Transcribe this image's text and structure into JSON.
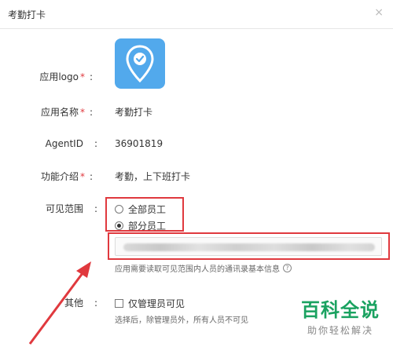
{
  "dialog": {
    "title": "考勤打卡",
    "close_glyph": "×"
  },
  "form": {
    "logo": {
      "label": "应用logo",
      "required_mark": "*",
      "colon": ":"
    },
    "name": {
      "label": "应用名称",
      "required_mark": "*",
      "colon": ":",
      "value": "考勤打卡"
    },
    "agent_id": {
      "label": "AgentID",
      "colon": ":",
      "value": "36901819"
    },
    "intro": {
      "label": "功能介绍",
      "required_mark": "*",
      "colon": ":",
      "value": "考勤，上下班打卡"
    },
    "visible_scope": {
      "label": "可见范围",
      "colon": ":",
      "options": [
        {
          "label": "全部员工",
          "checked": false
        },
        {
          "label": "部分员工",
          "checked": true
        }
      ],
      "hint": "应用需要读取可见范围内人员的通讯录基本信息",
      "help_glyph": "?"
    },
    "other": {
      "label": "其他",
      "colon": ":",
      "checkbox_label": "仅管理员可见",
      "checked": false,
      "hint": "选择后，除管理员外，所有人员不可见"
    }
  },
  "watermark": {
    "title": "百科全说",
    "subtitle": "助你轻松解决"
  },
  "colors": {
    "logo_bg": "#52a9ec",
    "highlight": "#e0393e",
    "required": "#e0393e",
    "watermark": "#1aa260"
  }
}
